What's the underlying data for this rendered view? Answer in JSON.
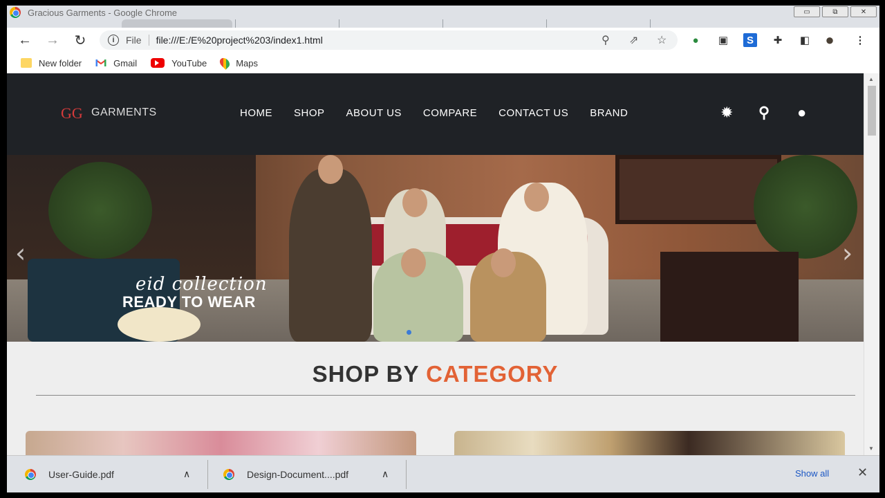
{
  "window": {
    "title": "Gracious Garments - Google Chrome",
    "controls": {
      "minimize": "▭",
      "restore": "⧉",
      "close": "✕"
    }
  },
  "toolbar": {
    "back_icon": "←",
    "forward_icon": "→",
    "reload_icon": "↻",
    "info_icon": "i",
    "file_label": "File",
    "url": "file:///E:/E%20project%203/index1.html",
    "zoom_icon": "⚲",
    "share_icon": "⇗",
    "star_icon": "☆",
    "ext_icons": [
      "globe-icon",
      "image-icon",
      "s-extension-icon",
      "puzzle-icon",
      "sidebar-icon",
      "avatar",
      "menu-kebab-icon"
    ],
    "ext_glyphs": [
      "●",
      "▣",
      "S",
      "✚",
      "◧",
      "●",
      "⋮"
    ]
  },
  "bookmarks": [
    {
      "label": "New folder",
      "icon": "folder-icon"
    },
    {
      "label": "Gmail",
      "icon": "gmail-icon"
    },
    {
      "label": "YouTube",
      "icon": "youtube-icon"
    },
    {
      "label": "Maps",
      "icon": "maps-icon"
    }
  ],
  "site": {
    "logo_mark": "GG",
    "logo_text": "GARMENTS",
    "menu": [
      "HOME",
      "SHOP",
      "ABOUT US",
      "COMPARE",
      "CONTACT US",
      "BRAND"
    ],
    "icons": {
      "settings": "✹",
      "search": "⚲",
      "user": "●"
    },
    "hero": {
      "script_text": "eid collection",
      "headline": "READY TO WEAR",
      "prev": "‹",
      "next": "›"
    },
    "category": {
      "title_main": "SHOP BY ",
      "title_accent": "CATEGORY"
    }
  },
  "downloads": {
    "items": [
      {
        "name": "User-Guide.pdf"
      },
      {
        "name": "Design-Document....pdf"
      }
    ],
    "chevron": "∧",
    "show_all": "Show all",
    "close": "✕"
  },
  "colors": {
    "accent": "#e26235",
    "nav_bg": "#1f2226",
    "logo_red": "#d63b3b"
  }
}
